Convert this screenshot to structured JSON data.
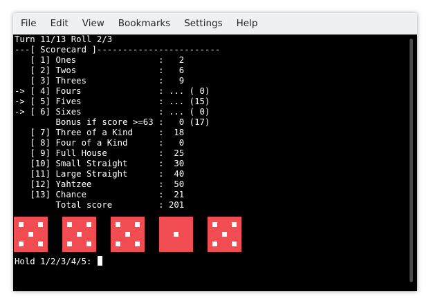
{
  "menu": [
    "File",
    "Edit",
    "View",
    "Bookmarks",
    "Settings",
    "Help"
  ],
  "terminal": {
    "lines": [
      "Turn 11/13 Roll 2/3",
      "---[ Scorecard ]------------------------",
      "   [ 1] Ones                :   2",
      "   [ 2] Twos                :   6",
      "   [ 3] Threes              :   9",
      "-> [ 4] Fours               : ... ( 0)",
      "-> [ 5] Fives               : ... (15)",
      "-> [ 6] Sixes               : ... ( 0)",
      "        Bonus if score >=63 :   0 (17)",
      "   [ 7] Three of a Kind     :  18",
      "   [ 8] Four of a Kind      :   0",
      "   [ 9] Full House          :  25",
      "   [10] Small Straight      :  30",
      "   [11] Large Straight      :  40",
      "   [12] Yahtzee             :  50",
      "   [13] Chance              :  21",
      "        Total score         : 201"
    ],
    "dice": [
      5,
      5,
      5,
      1,
      5
    ],
    "prompt": "Hold 1/2/3/4/5: "
  },
  "colors": {
    "die": "#f04c52",
    "pip": "#ffffff",
    "background": "#000000",
    "menubar": "#eff0f1"
  }
}
